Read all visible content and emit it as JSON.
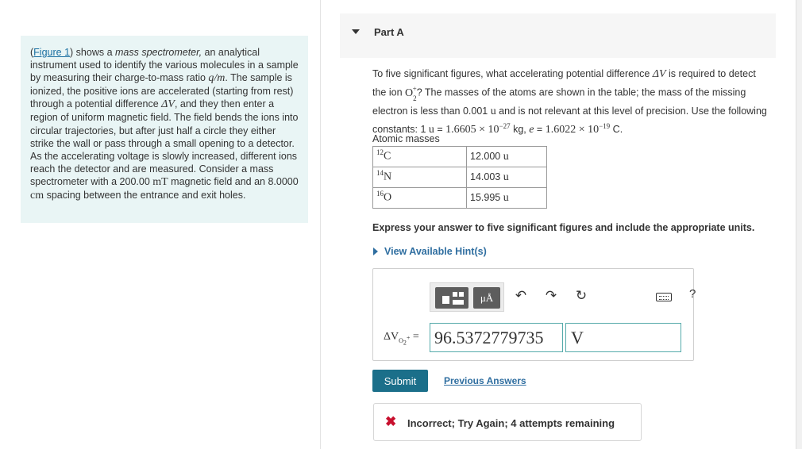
{
  "problem_intro": {
    "figure_link": "Figure 1",
    "segments": [
      ") shows a ",
      "mass spectrometer,",
      " an analytical instrument used to identify the various molecules in a sample by measuring their charge-to-mass ratio ",
      "q/m",
      ". The sample is ionized, the positive ions are accelerated (starting from rest) through a potential difference ",
      "ΔV",
      ", and they then enter a region of uniform magnetic field. The field bends the ions into circular trajectories, but after just half a circle they either strike the wall or pass through a small opening to a detector. As the accelerating voltage is slowly increased, different ions reach the detector and are measured. Consider a mass spectrometer with a 200.00 ",
      "mT",
      " magnetic field and an 8.0000 ",
      "cm",
      " spacing between the entrance and exit holes."
    ]
  },
  "part": {
    "title": "Part A"
  },
  "question": {
    "segments": [
      "To five significant figures, what accelerating potential difference ",
      "ΔV",
      " is required to detect the ion ",
      "O",
      "2",
      "+",
      "? The masses of the atoms are shown in the table; the mass of the missing electron is less than 0.001 ",
      "u",
      " and is not relevant at this level of precision. Use the following constants: 1 ",
      "u",
      " = ",
      "1.6605 × 10",
      "−27",
      " kg, ",
      "e",
      " = ",
      "1.6022 × 10",
      "−19",
      " C."
    ]
  },
  "atomic_masses": {
    "title": "Atomic masses",
    "rows": [
      {
        "mass_number": "12",
        "symbol": "C",
        "mass": "12.000",
        "unit": "u"
      },
      {
        "mass_number": "14",
        "symbol": "N",
        "mass": "14.003",
        "unit": "u"
      },
      {
        "mass_number": "16",
        "symbol": "O",
        "mass": "15.995",
        "unit": "u"
      }
    ]
  },
  "instruction": "Express your answer to five significant figures and include the appropriate units.",
  "hints_link": "View Available Hint(s)",
  "toolbar": {
    "units_button": "μÅ",
    "undo_icon": "undo-icon",
    "redo_icon": "redo-icon",
    "reset_icon": "reset-icon",
    "keyboard_icon": "keyboard-icon",
    "help": "?"
  },
  "answer": {
    "label_main": "ΔV",
    "label_sub_symbol": "O",
    "label_sub_index": "2",
    "label_sub_charge": "+",
    "label_equals": "=",
    "value": "96.5372779735",
    "unit": "V"
  },
  "submit_label": "Submit",
  "previous_answers_link": "Previous Answers",
  "feedback": {
    "icon": "x-icon",
    "message": "Incorrect; Try Again; 4 attempts remaining",
    "color": "#c8102e"
  }
}
